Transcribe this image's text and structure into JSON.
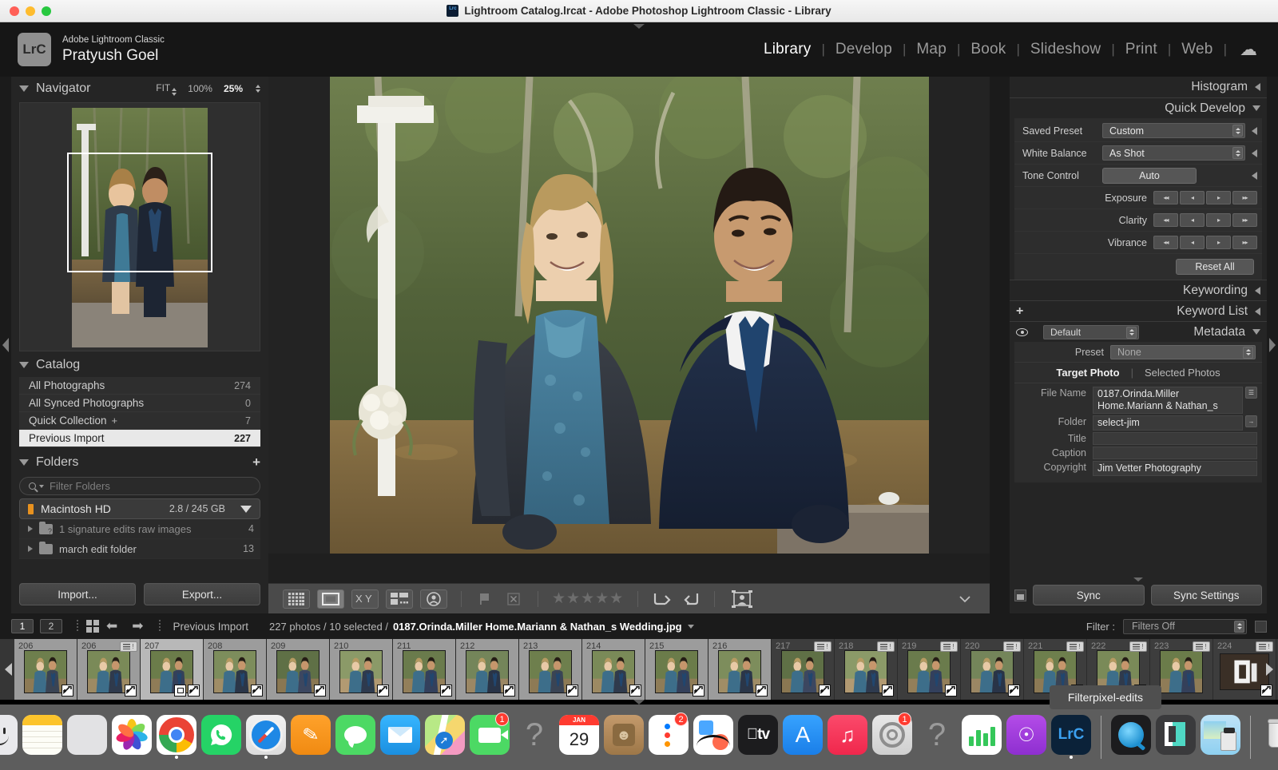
{
  "window": {
    "mac_title": "Lightroom Catalog.lrcat - Adobe Photoshop Lightroom Classic - Library",
    "app_icon": "lightroom-classic-icon"
  },
  "identity": {
    "logo_text": "LrC",
    "app_name": "Adobe Lightroom Classic",
    "user_name": "Pratyush Goel"
  },
  "modules": [
    {
      "label": "Library",
      "active": true
    },
    {
      "label": "Develop",
      "active": false
    },
    {
      "label": "Map",
      "active": false
    },
    {
      "label": "Book",
      "active": false
    },
    {
      "label": "Slideshow",
      "active": false
    },
    {
      "label": "Print",
      "active": false
    },
    {
      "label": "Web",
      "active": false
    }
  ],
  "left_panel": {
    "navigator": {
      "title": "Navigator",
      "zoom_fit": "FIT",
      "zoom_100": "100%",
      "zoom_current": "25%"
    },
    "catalog": {
      "title": "Catalog",
      "items": [
        {
          "label": "All Photographs",
          "count": "274",
          "selected": false
        },
        {
          "label": "All Synced Photographs",
          "count": "0",
          "selected": false
        },
        {
          "label": "Quick Collection",
          "count": "7",
          "selected": false,
          "plus": "+"
        },
        {
          "label": "Previous Import",
          "count": "227",
          "selected": true
        }
      ]
    },
    "folders": {
      "title": "Folders",
      "add_label": "+",
      "filter_placeholder": "Filter Folders",
      "volume": {
        "name": "Macintosh HD",
        "space": "2.8 / 245 GB"
      },
      "items": [
        {
          "label": "1 signature edits raw images",
          "count": "4",
          "missing": true
        },
        {
          "label": "march edit folder",
          "count": "13",
          "missing": false
        }
      ]
    },
    "buttons": {
      "import": "Import...",
      "export": "Export..."
    }
  },
  "toolbar": {
    "icons": [
      "grid-view-icon",
      "loupe-view-icon",
      "compare-view-icon",
      "survey-view-icon",
      "people-view-icon"
    ],
    "flag_icon": "flag-icon",
    "reject_icon": "reject-flag-icon",
    "stars": "★★★★★",
    "rotate_left_icon": "rotate-left-icon",
    "rotate_right_icon": "rotate-right-icon",
    "crop_icon": "crop-overlay-icon",
    "caret_icon": "chevron-down-icon"
  },
  "right_panel": {
    "histogram": {
      "title": "Histogram"
    },
    "quick_develop": {
      "title": "Quick Develop",
      "rows": [
        {
          "label": "Saved Preset",
          "value": "Custom",
          "type": "select"
        },
        {
          "label": "White Balance",
          "value": "As Shot",
          "type": "select"
        },
        {
          "label": "Tone Control",
          "value": "Auto",
          "type": "button"
        }
      ],
      "sliders": [
        {
          "label": "Exposure"
        },
        {
          "label": "Clarity"
        },
        {
          "label": "Vibrance"
        }
      ],
      "reset_label": "Reset All"
    },
    "keywording": {
      "title": "Keywording"
    },
    "keyword_list": {
      "title": "Keyword List",
      "add_label": "+"
    },
    "metadata": {
      "title": "Metadata",
      "view_preset": "Default",
      "preset_label": "Preset",
      "preset_value": "None",
      "tabs": [
        {
          "label": "Target Photo",
          "active": true
        },
        {
          "label": "Selected Photos",
          "active": false
        }
      ],
      "fields": [
        {
          "label": "File Name",
          "value": "0187.Orinda.Miller Home.Mariann & Nathan_s"
        },
        {
          "label": "Folder",
          "value": "select-jim"
        },
        {
          "label": "Title",
          "value": ""
        },
        {
          "label": "Caption",
          "value": ""
        },
        {
          "label": "Copyright",
          "value": "Jim Vetter Photography"
        }
      ]
    },
    "sync": {
      "sync_label": "Sync",
      "sync_settings_label": "Sync Settings"
    }
  },
  "filmstrip_bar": {
    "page1": "1",
    "page2": "2",
    "grid_icon": "grid-icon",
    "back_icon": "back-arrow-icon",
    "forward_icon": "forward-arrow-icon",
    "source": "Previous Import",
    "stats": "227 photos / 10 selected /",
    "filename": "0187.Orinda.Miller Home.Mariann & Nathan_s Wedding.jpg",
    "filter_label": "Filter :",
    "filter_value": "Filters Off"
  },
  "filmstrip": {
    "thumbs": [
      {
        "num": "206",
        "state": "partial-left",
        "badge_tr": false,
        "badge_br": "edit"
      },
      {
        "num": "206",
        "state": "selected",
        "badge_tr": true,
        "badge_br": "edit"
      },
      {
        "num": "207",
        "state": "active",
        "badge_tr": false,
        "badge_br": "edit",
        "badge_br2": true
      },
      {
        "num": "208",
        "state": "selected",
        "badge_tr": false,
        "badge_br": "edit"
      },
      {
        "num": "209",
        "state": "selected",
        "badge_tr": false,
        "badge_br": "edit"
      },
      {
        "num": "210",
        "state": "selected",
        "badge_tr": false,
        "badge_br": "edit"
      },
      {
        "num": "211",
        "state": "selected",
        "badge_tr": false,
        "badge_br": "edit"
      },
      {
        "num": "212",
        "state": "selected",
        "badge_tr": false,
        "badge_br": "edit"
      },
      {
        "num": "213",
        "state": "selected",
        "badge_tr": false,
        "badge_br": "edit"
      },
      {
        "num": "214",
        "state": "selected",
        "badge_tr": false,
        "badge_br": "edit"
      },
      {
        "num": "215",
        "state": "selected",
        "badge_tr": false,
        "badge_br": "edit"
      },
      {
        "num": "216",
        "state": "selected",
        "badge_tr": false,
        "badge_br": "edit"
      },
      {
        "num": "217",
        "state": "normal",
        "badge_tr": true,
        "badge_br": "edit"
      },
      {
        "num": "218",
        "state": "normal",
        "badge_tr": true,
        "badge_br": "edit"
      },
      {
        "num": "219",
        "state": "normal",
        "badge_tr": true,
        "badge_br": "edit"
      },
      {
        "num": "220",
        "state": "normal",
        "badge_tr": true,
        "badge_br": "edit"
      },
      {
        "num": "221",
        "state": "normal",
        "badge_tr": true,
        "badge_br": "edit"
      },
      {
        "num": "222",
        "state": "normal",
        "badge_tr": true,
        "badge_br": "plus"
      },
      {
        "num": "223",
        "state": "normal",
        "badge_tr": true,
        "badge_br": ""
      },
      {
        "num": "224",
        "state": "normal",
        "badge_tr": true,
        "badge_br": "edit"
      }
    ],
    "tooltip": "Filterpixel-edits"
  },
  "dock": {
    "items": [
      {
        "name": "finder",
        "badge": "",
        "running": true
      },
      {
        "name": "notes",
        "badge": "",
        "running": false
      },
      {
        "name": "launchpad",
        "badge": "",
        "running": false
      },
      {
        "name": "photos",
        "badge": "",
        "running": false
      },
      {
        "name": "chrome",
        "badge": "",
        "running": true
      },
      {
        "name": "whatsapp",
        "badge": "",
        "running": false
      },
      {
        "name": "safari",
        "badge": "",
        "running": true
      },
      {
        "name": "pages",
        "badge": "",
        "running": false
      },
      {
        "name": "messages",
        "badge": "",
        "running": false
      },
      {
        "name": "mail",
        "badge": "",
        "running": false
      },
      {
        "name": "maps",
        "badge": "",
        "running": false
      },
      {
        "name": "facetime",
        "badge": "1",
        "running": false
      },
      {
        "name": "help",
        "badge": "",
        "running": false
      },
      {
        "name": "calendar",
        "badge": "",
        "running": false,
        "month": "JAN",
        "day": "29"
      },
      {
        "name": "contacts",
        "badge": "",
        "running": false
      },
      {
        "name": "reminders",
        "badge": "2",
        "running": false
      },
      {
        "name": "freeform",
        "badge": "",
        "running": false
      },
      {
        "name": "appletv",
        "badge": "",
        "running": false
      },
      {
        "name": "appstore",
        "badge": "",
        "running": false
      },
      {
        "name": "music",
        "badge": "",
        "running": false
      },
      {
        "name": "settings",
        "badge": "1",
        "running": false
      },
      {
        "name": "help2",
        "badge": "",
        "running": false
      },
      {
        "name": "numbers",
        "badge": "",
        "running": false
      },
      {
        "name": "podcasts",
        "badge": "",
        "running": false
      },
      {
        "name": "lightroom-classic",
        "badge": "",
        "running": true
      },
      {
        "name": "quicktime",
        "badge": "",
        "running": false
      },
      {
        "name": "filterpixel",
        "badge": "",
        "running": false
      },
      {
        "name": "preview",
        "badge": "",
        "running": false
      },
      {
        "name": "trash",
        "badge": "",
        "running": false
      }
    ]
  }
}
